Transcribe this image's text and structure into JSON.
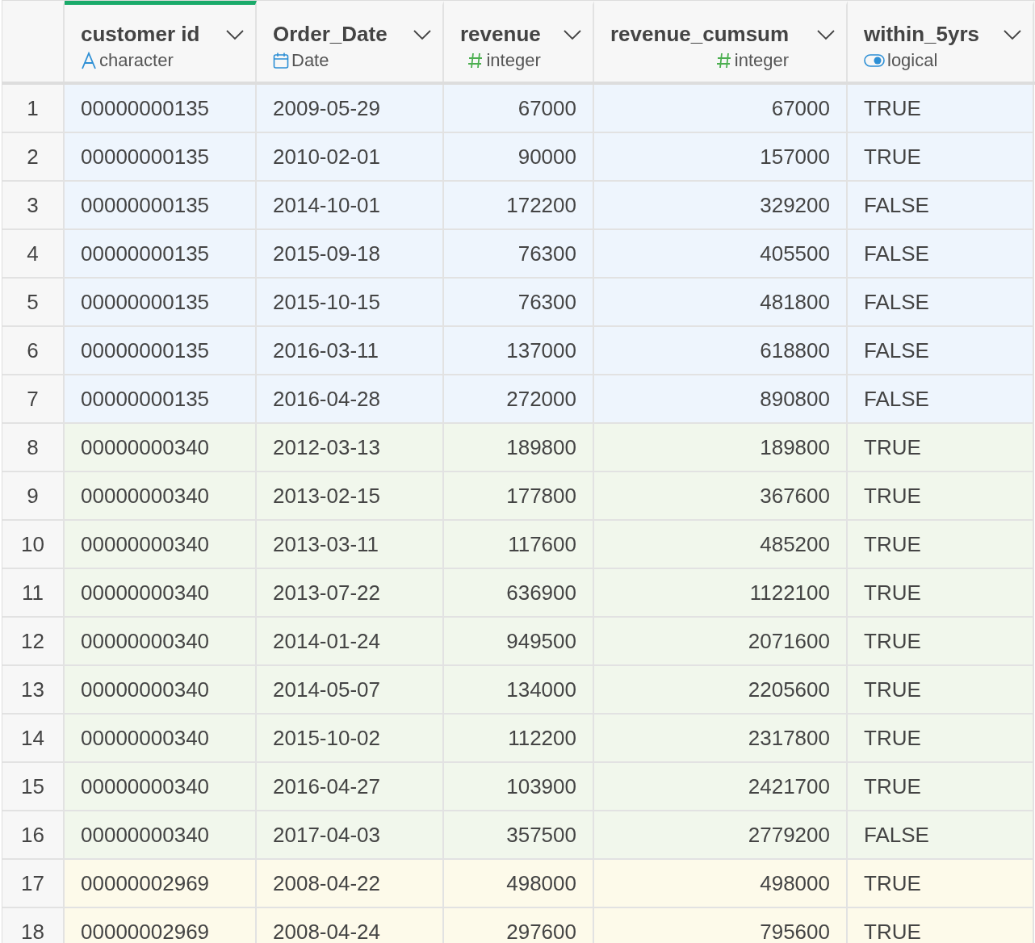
{
  "columns": [
    {
      "name": "customer id",
      "type": "character",
      "kind": "character",
      "selected": true
    },
    {
      "name": "Order_Date",
      "type": "Date",
      "kind": "date",
      "selected": false
    },
    {
      "name": "revenue",
      "type": "integer",
      "kind": "integer",
      "selected": false
    },
    {
      "name": "revenue_cumsum",
      "type": "integer",
      "kind": "integer",
      "selected": false
    },
    {
      "name": "within_5yrs",
      "type": "logical",
      "kind": "logical",
      "selected": false
    }
  ],
  "rows": [
    {
      "index": "1",
      "color": "#eef5fd",
      "cells": [
        "00000000135",
        "2009-05-29",
        "67000",
        "67000",
        "TRUE"
      ]
    },
    {
      "index": "2",
      "color": "#eef5fd",
      "cells": [
        "00000000135",
        "2010-02-01",
        "90000",
        "157000",
        "TRUE"
      ]
    },
    {
      "index": "3",
      "color": "#eef5fd",
      "cells": [
        "00000000135",
        "2014-10-01",
        "172200",
        "329200",
        "FALSE"
      ]
    },
    {
      "index": "4",
      "color": "#eef5fd",
      "cells": [
        "00000000135",
        "2015-09-18",
        "76300",
        "405500",
        "FALSE"
      ]
    },
    {
      "index": "5",
      "color": "#eef5fd",
      "cells": [
        "00000000135",
        "2015-10-15",
        "76300",
        "481800",
        "FALSE"
      ]
    },
    {
      "index": "6",
      "color": "#eef5fd",
      "cells": [
        "00000000135",
        "2016-03-11",
        "137000",
        "618800",
        "FALSE"
      ]
    },
    {
      "index": "7",
      "color": "#eef5fd",
      "cells": [
        "00000000135",
        "2016-04-28",
        "272000",
        "890800",
        "FALSE"
      ]
    },
    {
      "index": "8",
      "color": "#f1f7ec",
      "cells": [
        "00000000340",
        "2012-03-13",
        "189800",
        "189800",
        "TRUE"
      ]
    },
    {
      "index": "9",
      "color": "#f1f7ec",
      "cells": [
        "00000000340",
        "2013-02-15",
        "177800",
        "367600",
        "TRUE"
      ]
    },
    {
      "index": "10",
      "color": "#f1f7ec",
      "cells": [
        "00000000340",
        "2013-03-11",
        "117600",
        "485200",
        "TRUE"
      ]
    },
    {
      "index": "11",
      "color": "#f1f7ec",
      "cells": [
        "00000000340",
        "2013-07-22",
        "636900",
        "1122100",
        "TRUE"
      ]
    },
    {
      "index": "12",
      "color": "#f1f7ec",
      "cells": [
        "00000000340",
        "2014-01-24",
        "949500",
        "2071600",
        "TRUE"
      ]
    },
    {
      "index": "13",
      "color": "#f1f7ec",
      "cells": [
        "00000000340",
        "2014-05-07",
        "134000",
        "2205600",
        "TRUE"
      ]
    },
    {
      "index": "14",
      "color": "#f1f7ec",
      "cells": [
        "00000000340",
        "2015-10-02",
        "112200",
        "2317800",
        "TRUE"
      ]
    },
    {
      "index": "15",
      "color": "#f1f7ec",
      "cells": [
        "00000000340",
        "2016-04-27",
        "103900",
        "2421700",
        "TRUE"
      ]
    },
    {
      "index": "16",
      "color": "#f1f7ec",
      "cells": [
        "00000000340",
        "2017-04-03",
        "357500",
        "2779200",
        "FALSE"
      ]
    },
    {
      "index": "17",
      "color": "#fdfaea",
      "cells": [
        "00000002969",
        "2008-04-22",
        "498000",
        "498000",
        "TRUE"
      ]
    },
    {
      "index": "18",
      "color": "#fdfaea",
      "cells": [
        "00000002969",
        "2008-04-24",
        "297600",
        "795600",
        "TRUE"
      ]
    }
  ]
}
